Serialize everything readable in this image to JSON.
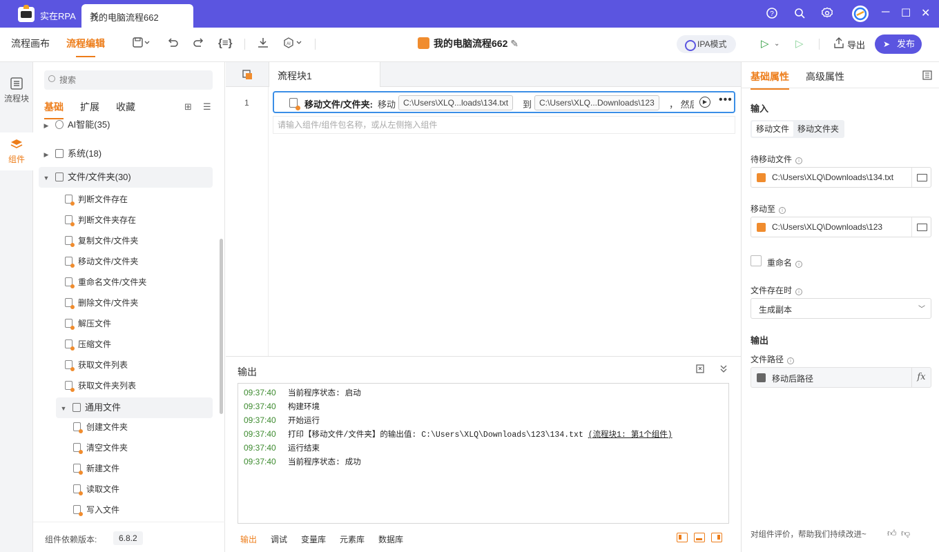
{
  "titlebar": {
    "app_name": "实在RPA",
    "tab_title": "我的电脑流程662",
    "tab_close": "✕",
    "help_icon": "help-icon",
    "search_icon": "search-icon",
    "settings_icon": "gear-icon"
  },
  "toolbar": {
    "nav_canvas": "流程画布",
    "nav_edit": "流程编辑",
    "flow_name": "我的电脑流程662",
    "ipa_mode": "IPA模式",
    "export": "导出",
    "publish": "发布"
  },
  "leftnav": {
    "flow_block": "流程块",
    "components": "组件"
  },
  "components": {
    "search_placeholder": "搜索",
    "tabs": [
      "基础",
      "扩展",
      "收藏"
    ],
    "categories": [
      {
        "label": "AI智能(35)"
      },
      {
        "label": "系统(18)"
      },
      {
        "label": "文件/文件夹(30)"
      }
    ],
    "file_items": [
      "判断文件存在",
      "判断文件夹存在",
      "复制文件/文件夹",
      "移动文件/文件夹",
      "重命名文件/文件夹",
      "删除文件/文件夹",
      "解压文件",
      "压缩文件",
      "获取文件列表",
      "获取文件夹列表"
    ],
    "general_file": "通用文件",
    "general_items": [
      "创建文件夹",
      "清空文件夹",
      "新建文件",
      "读取文件",
      "写入文件"
    ],
    "version_label": "组件依赖版本:",
    "version_value": "6.8.2"
  },
  "editor": {
    "tab_label": "流程块1",
    "tab_close": "✕",
    "line_number": "1",
    "step": {
      "name": "移动文件/文件夹:",
      "verb": "移动",
      "source": "C:\\Users\\XLQ...loads\\134.txt",
      "to": "到",
      "target": "C:\\Users\\XLQ...Downloads\\123",
      "tail": "，  然后"
    },
    "add_hint": "请输入组件/组件包名称，或从左侧拖入组件"
  },
  "output": {
    "title": "输出",
    "logs": [
      {
        "time": "09:37:40",
        "msg": "当前程序状态: 启动"
      },
      {
        "time": "09:37:40",
        "msg": "构建环境"
      },
      {
        "time": "09:37:40",
        "msg": "开始运行"
      },
      {
        "time": "09:37:40",
        "msg": "打印【移动文件/文件夹】的输出值: C:\\Users\\XLQ\\Downloads\\123\\134.txt ",
        "link": "(流程块1: 第1个组件)"
      },
      {
        "time": "09:37:40",
        "msg": "运行结束"
      },
      {
        "time": "09:37:40",
        "msg": "当前程序状态: 成功"
      }
    ],
    "bottom_tabs": [
      "输出",
      "调试",
      "变量库",
      "元素库",
      "数据库"
    ]
  },
  "props": {
    "tab_basic": "基础属性",
    "tab_advanced": "高级属性",
    "input_section": "输入",
    "seg_file": "移动文件",
    "seg_folder": "移动文件夹",
    "src_label": "待移动文件",
    "src_value": "C:\\Users\\XLQ\\Downloads\\134.txt",
    "dst_label": "移动至",
    "dst_value": "C:\\Users\\XLQ\\Downloads\\123",
    "rename_label": "重命名",
    "exists_label": "文件存在时",
    "exists_value": "生成副本",
    "output_section": "输出",
    "outpath_label": "文件路径",
    "outpath_value": "移动后路径",
    "fx": "fx",
    "feedback": "对组件评价，帮助我们持续改进~"
  }
}
